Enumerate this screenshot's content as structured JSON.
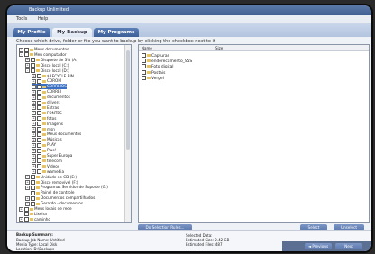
{
  "window": {
    "title": "Backup Unlimited",
    "menu": [
      "Tools",
      "Help"
    ]
  },
  "tabs": [
    {
      "label": "My Profile",
      "active": false
    },
    {
      "label": "My Backup",
      "active": true
    },
    {
      "label": "My Programs",
      "active": false
    }
  ],
  "instructions": "Choose which drive, folder or file you want to backup by clicking the checkbox next to it",
  "tree": {
    "items": [
      {
        "label": "Meus documentos",
        "level": 0,
        "expander": "+"
      },
      {
        "label": "Meu computador",
        "level": 0,
        "expander": "-"
      },
      {
        "label": "Disquete de 3½ (A:)",
        "level": 1,
        "expander": "+"
      },
      {
        "label": "Disco local (C:)",
        "level": 1,
        "expander": "+"
      },
      {
        "label": "Disco local (D:)",
        "level": 1,
        "expander": "-"
      },
      {
        "label": "$RECYCLE.BIN",
        "level": 2,
        "expander": "+"
      },
      {
        "label": "CDROM",
        "level": 2,
        "expander": "+"
      },
      {
        "label": "CORREIOS",
        "level": 2,
        "expander": "+",
        "selected": true
      },
      {
        "label": "CORREI",
        "level": 2,
        "expander": "+"
      },
      {
        "label": "documentos",
        "level": 2,
        "expander": "+"
      },
      {
        "label": "drivers",
        "level": 2,
        "expander": "+"
      },
      {
        "label": "Extras",
        "level": 2,
        "expander": "+"
      },
      {
        "label": "FONTES",
        "level": 2,
        "expander": "+"
      },
      {
        "label": "fotos",
        "level": 2,
        "expander": "+"
      },
      {
        "label": "Imagens",
        "level": 2,
        "expander": "+"
      },
      {
        "label": "msn",
        "level": 2,
        "expander": "+"
      },
      {
        "label": "Meus documentos",
        "level": 2,
        "expander": "+"
      },
      {
        "label": "Músicas",
        "level": 2,
        "expander": "+"
      },
      {
        "label": "PLAY",
        "level": 2,
        "expander": "+"
      },
      {
        "label": "Plus!",
        "level": 2,
        "expander": "+"
      },
      {
        "label": "Super Europa",
        "level": 2,
        "expander": "+"
      },
      {
        "label": "telecom",
        "level": 2,
        "expander": "+"
      },
      {
        "label": "Vídeos",
        "level": 2,
        "expander": "+"
      },
      {
        "label": "wamedia",
        "level": 2,
        "expander": "+"
      },
      {
        "label": "Unidade de CD (E:)",
        "level": 1,
        "expander": "+"
      },
      {
        "label": "Disco removível (F:)",
        "level": 1,
        "expander": "+"
      },
      {
        "label": "Programas Servidor de Suporte (G:)",
        "level": 1,
        "expander": "+"
      },
      {
        "label": "Painel de controle",
        "level": 1,
        "expander": ""
      },
      {
        "label": "Documentos compartilhados",
        "level": 1,
        "expander": "+"
      },
      {
        "label": "Gerardo - documentos",
        "level": 1,
        "expander": "+"
      },
      {
        "label": "Meus locais de rede",
        "level": 0,
        "expander": "+"
      },
      {
        "label": "Lixeira",
        "level": 0,
        "expander": ""
      },
      {
        "label": "caminho",
        "level": 0,
        "expander": "+"
      }
    ]
  },
  "list": {
    "columns": [
      "Name",
      "Size"
    ],
    "rows": [
      {
        "name": "Capturas"
      },
      {
        "name": "enderecamento_S5S"
      },
      {
        "name": "Foto digital"
      },
      {
        "name": "Postais"
      },
      {
        "name": "Vergel"
      }
    ]
  },
  "buttons": {
    "select_all": "Do Selection Rules...",
    "select": "Select",
    "unselect": "Unselect",
    "previous": "◄ Previous",
    "next": "Next"
  },
  "summary": {
    "title": "Backup Summary:",
    "lines": [
      "Backup Job Name: Untitled",
      "Media Type: Local Disk",
      "Location: D:\\Backups"
    ],
    "right_lines": [
      "Selected Data:",
      "Estimated Size: 2.42 GB",
      "Estimated Files: 487"
    ]
  },
  "colors": {
    "accent": "#3b6fc4",
    "tab_bg": "#4d6fa8",
    "frame": "#0c0c0c"
  }
}
